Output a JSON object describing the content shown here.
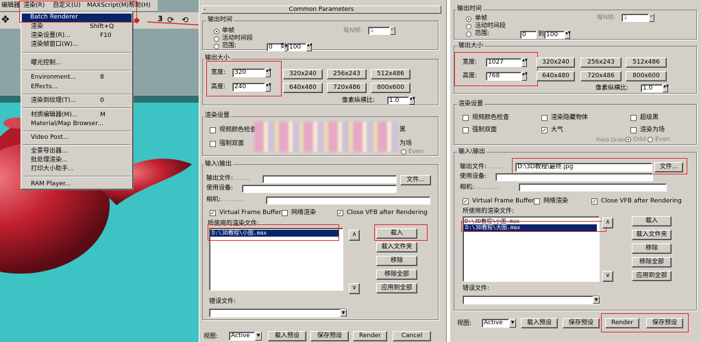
{
  "colors": {
    "viewport_bg": "#3dc3c3",
    "teapot": "#c2202f",
    "highlight": "#e0262b",
    "selection": "#0a246a"
  },
  "menubar": {
    "items": [
      "编辑器",
      "渲染(R)",
      "自定义(U)",
      "MAXScript(M)",
      "帮助(H)"
    ],
    "toolbar_glyph": "3"
  },
  "menu": {
    "items": [
      {
        "label": "Batch Renderer",
        "shortcut": ""
      },
      {
        "label": "渲染",
        "shortcut": "Shift+Q"
      },
      {
        "label": "渲染设置(R)...",
        "shortcut": "F10"
      },
      {
        "label": "渲染帧窗口(W)...",
        "shortcut": ""
      },
      {
        "label": "曝光控制...",
        "shortcut": ""
      },
      {
        "label": "Environment...",
        "shortcut": "8"
      },
      {
        "label": "Effects...",
        "shortcut": ""
      },
      {
        "label": "渲染到纹理(T)...",
        "shortcut": "0"
      },
      {
        "label": "材质编辑器(M)...",
        "shortcut": "M"
      },
      {
        "label": "Material/Map Browser...",
        "shortcut": ""
      },
      {
        "label": "Video Post...",
        "shortcut": ""
      },
      {
        "label": "全景导出器...",
        "shortcut": ""
      },
      {
        "label": "批处理渲染...",
        "shortcut": ""
      },
      {
        "label": "打印大小助手...",
        "shortcut": ""
      },
      {
        "label": "RAM Player...",
        "shortcut": ""
      }
    ]
  },
  "left": {
    "common_params_title": "Common Parameters",
    "time_output": {
      "title": "输出时间",
      "single": "单帧",
      "active": "活动时间段",
      "range": "范围:",
      "range_from": "0",
      "range_to": "100",
      "range_sep": "到",
      "every_nth": "每N帧:",
      "every_nth_value": "1"
    },
    "output_size": {
      "title": "输出大小",
      "width_label": "宽度:",
      "width": "320",
      "height_label": "高度:",
      "height": "240",
      "presets": [
        "320x240",
        "256x243",
        "512x486",
        "640x480",
        "720x486",
        "800x600"
      ],
      "aspect_label": "像素纵横比:",
      "aspect": "1.0"
    },
    "options": {
      "title": "渲染设置",
      "video_check": "视频颜色检查",
      "force_2sided": "强制双面",
      "tail_1": "黑",
      "tail_2": "为场",
      "even": "Even"
    },
    "io": {
      "title": "输入\\输出",
      "output_file": "输出文件:",
      "use_device": "使用设备:",
      "camera": "相机:",
      "file_btn": "文件...",
      "vfb": "Virtual Frame Buffer",
      "net_render": "网络渲染",
      "close_vfb": "Close VFB after Rendering",
      "used_files": "所使用的渲染文件:",
      "file_list": [
        "D:\\3D教程\\小图.max"
      ],
      "btn_load": "载入",
      "btn_load_folder": "载入文件夹",
      "btn_remove": "移除",
      "btn_remove_all": "移除全部",
      "btn_apply_all": "应用到全部",
      "error_file": "错误文件:"
    },
    "bottom": {
      "view_label": "视图:",
      "view_value": "Active",
      "load_preset": "载入预设",
      "save_preset": "保存预设",
      "render": "Render",
      "cancel": "Cancel"
    }
  },
  "right": {
    "time_output": {
      "title": "输出时间",
      "single": "单帧",
      "active": "活动时间段",
      "range": "范围:",
      "range_from": "0",
      "range_to": "100",
      "range_sep": "到",
      "every_nth": "每N帧:",
      "every_nth_value": "1"
    },
    "output_size": {
      "title": "输出大小",
      "width_label": "宽度:",
      "width": "1027",
      "height_label": "高度:",
      "height": "768",
      "presets": [
        "320x240",
        "256x243",
        "512x486",
        "720x486",
        "640x480",
        "800x600"
      ],
      "aspect_label": "像素纵横比:",
      "aspect": "1.0"
    },
    "options": {
      "title": "渲染设置",
      "video_check": "视频颜色检查",
      "render_hidden": "渲染隐藏物体",
      "super_black": "超级黑",
      "force_2sided": "强制双面",
      "atmosphere": "大气",
      "render_fields": "渲染为场",
      "field_order": "Field Order",
      "odd": "Odd",
      "even": "Even"
    },
    "io": {
      "title": "输入\\输出",
      "output_file": "输出文件:",
      "output_path": "D:\\3D教程\\最终.jpg",
      "file_btn": "文件...",
      "use_device": "使用设备:",
      "camera": "相机:",
      "vfb": "Virtual Frame Buffer",
      "net_render": "网络渲染",
      "close_vfb": "Close VFB after Rendering",
      "used_files": "所使用的渲染文件:",
      "file_list": [
        "D:\\3D教程\\小图.max",
        "D:\\3D教程\\大图.max"
      ],
      "btn_load": "载入",
      "btn_load_folder": "载入文件夹",
      "btn_remove": "移除",
      "btn_remove_all": "移除全部",
      "btn_apply_all": "应用到全部",
      "error_file": "错误文件:"
    },
    "bottom": {
      "view_label": "视图:",
      "view_value": "Active",
      "load_preset": "载入预设",
      "save_preset": "保存预设",
      "render": "Render",
      "cancel": "保存预设"
    }
  }
}
